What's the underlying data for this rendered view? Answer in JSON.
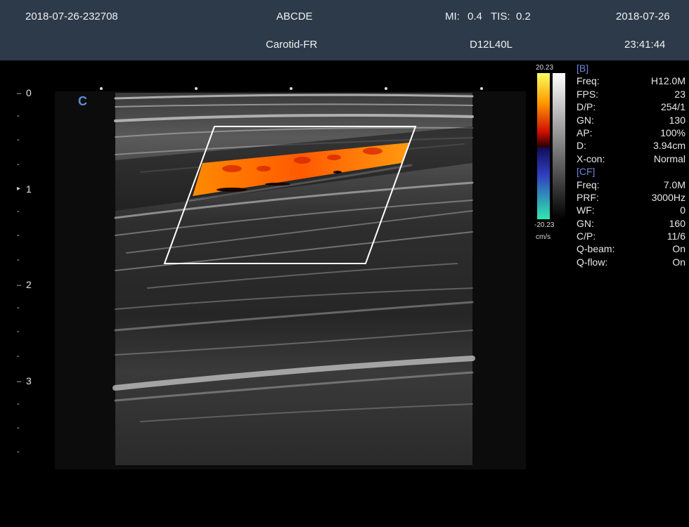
{
  "header": {
    "patient_id": "2018-07-26-232708",
    "patient_name": "ABCDE",
    "mi_label": "MI:",
    "mi_value": "0.4",
    "tis_label": "TIS:",
    "tis_value": "0.2",
    "date": "2018-07-26",
    "preset": "Carotid-FR",
    "probe": "D12L40L",
    "time": "23:41:44"
  },
  "depth_scale": {
    "labels": [
      "0",
      "1",
      "2",
      "3"
    ],
    "focus_marker": "▸"
  },
  "image_area": {
    "orientation_mark": "C"
  },
  "colorbar": {
    "max": "20.23",
    "min": "-20.23",
    "unit": "cm/s"
  },
  "params": {
    "b_header": "[B]",
    "b_rows": [
      {
        "label": "Freq:",
        "value": "H12.0M"
      },
      {
        "label": "FPS:",
        "value": "23"
      },
      {
        "label": "D/P:",
        "value": "254/1"
      },
      {
        "label": "GN:",
        "value": "130"
      },
      {
        "label": "AP:",
        "value": "100%"
      },
      {
        "label": "D:",
        "value": "3.94cm"
      },
      {
        "label": "X-con:",
        "value": "Normal"
      }
    ],
    "cf_header": "[CF]",
    "cf_rows": [
      {
        "label": "Freq:",
        "value": "7.0M"
      },
      {
        "label": "PRF:",
        "value": "3000Hz"
      },
      {
        "label": "WF:",
        "value": "0"
      },
      {
        "label": "GN:",
        "value": "160"
      },
      {
        "label": "C/P:",
        "value": "11/6"
      },
      {
        "label": "Q-beam:",
        "value": "On"
      },
      {
        "label": "Q-flow:",
        "value": "On"
      }
    ]
  },
  "colors": {
    "header_bg": "#2d3a4a",
    "section_header": "#6e86d8",
    "orientation_mark": "#5b8fd6"
  }
}
